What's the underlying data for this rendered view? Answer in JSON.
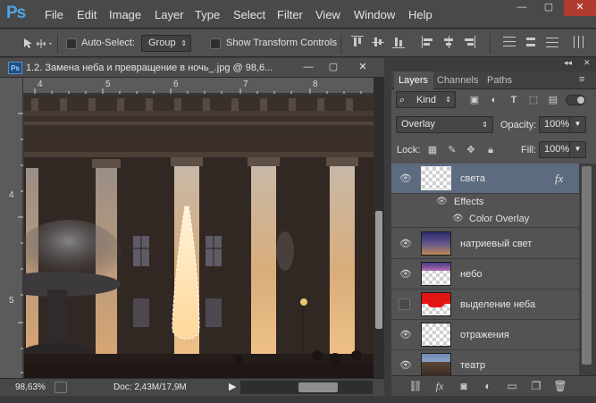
{
  "app": {
    "logo": "Ps"
  },
  "menu": [
    "File",
    "Edit",
    "Image",
    "Layer",
    "Type",
    "Select",
    "Filter",
    "View",
    "Window",
    "Help"
  ],
  "window_controls": {
    "minimize": "—",
    "restore": "▢",
    "close": "✕"
  },
  "options": {
    "auto_select_label": "Auto-Select:",
    "auto_select_checked": false,
    "group_value": "Group",
    "show_transform_label": "Show Transform Controls",
    "show_transform_checked": false
  },
  "document": {
    "title": "1.2. Замена неба и превращение в ночь_.jpg @ 98,6...",
    "ruler_top": [
      "4",
      "5",
      "6",
      "7",
      "8"
    ],
    "ruler_left": [
      "4",
      "5"
    ],
    "zoom": "98,63%",
    "doc_info": "Doc: 2,43M/17,9M"
  },
  "panel": {
    "tabs": [
      {
        "label": "Layers",
        "active": true
      },
      {
        "label": "Channels",
        "active": false
      },
      {
        "label": "Paths",
        "active": false
      }
    ],
    "filter_kind": "Kind",
    "blend_mode": "Overlay",
    "opacity_label": "Opacity:",
    "opacity_value": "100%",
    "lock_label": "Lock:",
    "fill_label": "Fill:",
    "fill_value": "100%",
    "fx_badge": "fx",
    "layers": [
      {
        "name": "света",
        "visible": true,
        "selected": true,
        "thumb": "transparent",
        "has_fx": true
      },
      {
        "name": "натриевый свет",
        "visible": true,
        "selected": false,
        "thumb": "gradient"
      },
      {
        "name": "небо",
        "visible": true,
        "selected": false,
        "thumb": "sky"
      },
      {
        "name": "выделение неба",
        "visible": false,
        "selected": false,
        "thumb": "red-mask"
      },
      {
        "name": "отражения",
        "visible": true,
        "selected": false,
        "thumb": "transparent"
      },
      {
        "name": "театр",
        "visible": true,
        "selected": false,
        "thumb": "photo"
      }
    ],
    "effects_label": "Effects",
    "color_overlay_label": "Color Overlay"
  }
}
